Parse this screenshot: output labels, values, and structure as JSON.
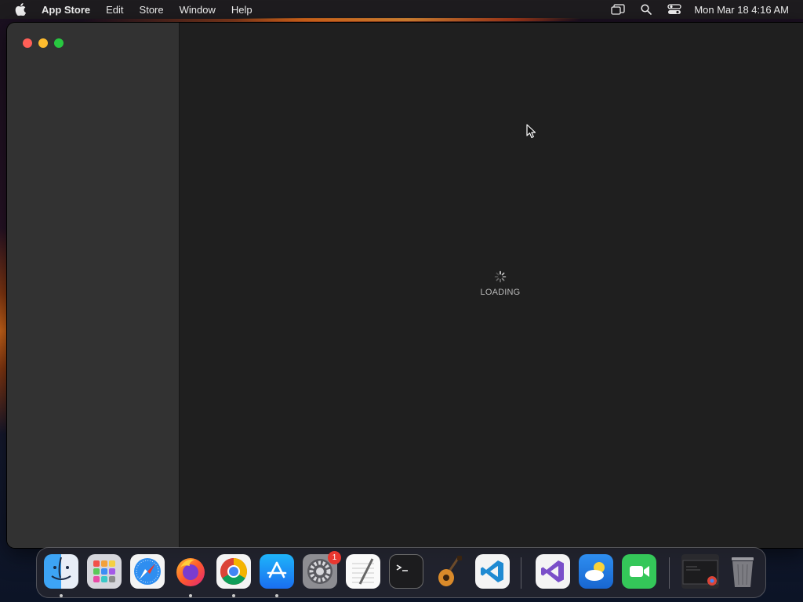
{
  "menubar": {
    "app_name": "App Store",
    "items": [
      "Edit",
      "Store",
      "Window",
      "Help"
    ],
    "clock": "Mon Mar 18  4:16 AM"
  },
  "window": {
    "loading_text": "LOADING"
  },
  "dock": {
    "apps": [
      {
        "name": "Finder",
        "icon": "finder-icon",
        "running": true
      },
      {
        "name": "Launchpad",
        "icon": "launchpad-icon",
        "running": false
      },
      {
        "name": "Safari",
        "icon": "safari-icon",
        "running": false
      },
      {
        "name": "Firefox",
        "icon": "firefox-icon",
        "running": true
      },
      {
        "name": "Google Chrome",
        "icon": "chrome-icon",
        "running": true
      },
      {
        "name": "App Store",
        "icon": "app-store-icon",
        "running": true
      },
      {
        "name": "System Preferences",
        "icon": "system-preferences-icon",
        "running": false
      },
      {
        "name": "TextEdit",
        "icon": "textedit-icon",
        "running": false
      },
      {
        "name": "Terminal",
        "icon": "terminal-icon",
        "running": false
      },
      {
        "name": "GarageBand",
        "icon": "garageband-icon",
        "running": false
      },
      {
        "name": "Visual Studio Code",
        "icon": "vscode-icon",
        "running": false
      },
      {
        "name": "Visual Studio",
        "icon": "visual-studio-icon",
        "running": false
      },
      {
        "name": "Weather",
        "icon": "weather-icon",
        "running": false
      },
      {
        "name": "FaceTime",
        "icon": "facetime-icon",
        "running": false
      },
      {
        "name": "Chrome Window",
        "icon": "chrome-window-thumbnail",
        "running": false
      },
      {
        "name": "Trash",
        "icon": "trash-icon",
        "running": false
      }
    ],
    "badge_count": "1"
  },
  "colors": {
    "menubar_bg": "#1e1c1f",
    "sidebar_bg": "#323232",
    "content_bg": "#1f1f1f",
    "badge": "#e8372f"
  }
}
